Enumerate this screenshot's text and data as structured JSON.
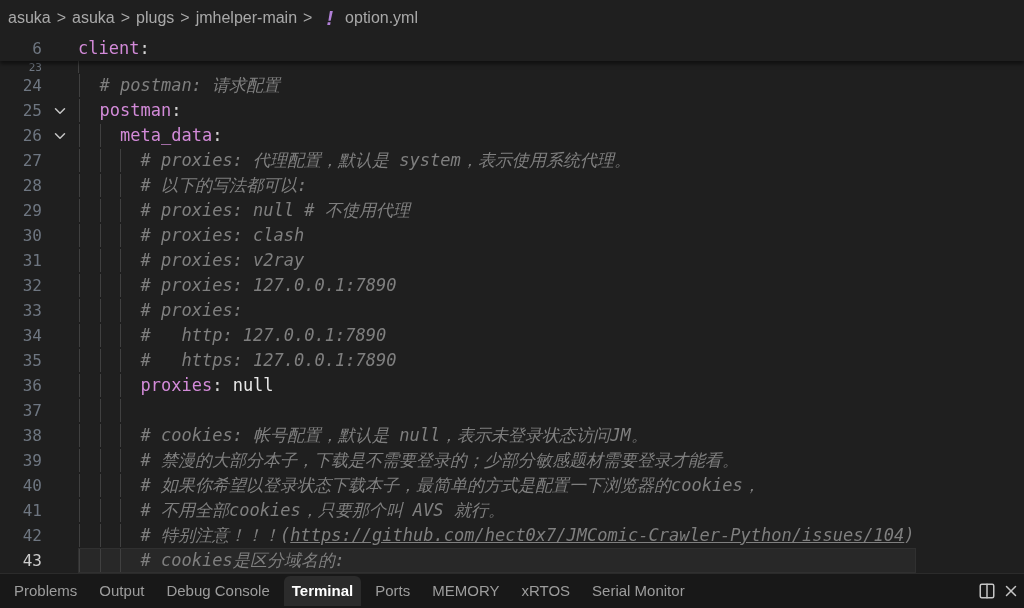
{
  "breadcrumb": {
    "items": [
      "asuka",
      "asuka",
      "plugs",
      "jmhelper-main"
    ],
    "separator": ">",
    "file_icon": "!",
    "file": "option.yml"
  },
  "sticky_line": {
    "number": "6",
    "tokens": [
      {
        "kind": "key",
        "text": "client"
      },
      {
        "kind": "punct",
        "text": ":"
      }
    ]
  },
  "peek_line": {
    "number": "23"
  },
  "lines": [
    {
      "number": "24",
      "current": false,
      "tokens": [
        {
          "kind": "comment",
          "text": "# postman: 请求配置"
        }
      ]
    },
    {
      "number": "25",
      "current": false,
      "expanded": true,
      "tokens": [
        {
          "kind": "key",
          "text": "postman"
        },
        {
          "kind": "punct",
          "text": ":"
        }
      ],
      "children": [
        {
          "number": "26",
          "current": false,
          "expanded": true,
          "tokens": [
            {
              "kind": "key",
              "text": "meta_data"
            },
            {
              "kind": "punct",
              "text": ":"
            }
          ],
          "children": [
            {
              "number": "27",
              "current": false,
              "tokens": [
                {
                  "kind": "comment",
                  "text": "# proxies: 代理配置，默认是 system，表示使用系统代理。"
                }
              ]
            },
            {
              "number": "28",
              "current": false,
              "tokens": [
                {
                  "kind": "comment",
                  "text": "# 以下的写法都可以:"
                }
              ]
            },
            {
              "number": "29",
              "current": false,
              "tokens": [
                {
                  "kind": "comment",
                  "text": "# proxies: null # 不使用代理"
                }
              ]
            },
            {
              "number": "30",
              "current": false,
              "tokens": [
                {
                  "kind": "comment",
                  "text": "# proxies: clash"
                }
              ]
            },
            {
              "number": "31",
              "current": false,
              "tokens": [
                {
                  "kind": "comment",
                  "text": "# proxies: v2ray"
                }
              ]
            },
            {
              "number": "32",
              "current": false,
              "tokens": [
                {
                  "kind": "comment",
                  "text": "# proxies: 127.0.0.1:7890"
                }
              ]
            },
            {
              "number": "33",
              "current": false,
              "tokens": [
                {
                  "kind": "comment",
                  "text": "# proxies:"
                }
              ]
            },
            {
              "number": "34",
              "current": false,
              "tokens": [
                {
                  "kind": "comment",
                  "text": "#   http: 127.0.0.1:7890"
                }
              ]
            },
            {
              "number": "35",
              "current": false,
              "tokens": [
                {
                  "kind": "comment",
                  "text": "#   https: 127.0.0.1:7890"
                }
              ]
            },
            {
              "number": "36",
              "current": false,
              "tokens": [
                {
                  "kind": "key",
                  "text": "proxies"
                },
                {
                  "kind": "punct",
                  "text": ": "
                },
                {
                  "kind": "value",
                  "text": "null"
                }
              ]
            },
            {
              "number": "37",
              "current": false
            },
            {
              "number": "38",
              "current": false,
              "tokens": [
                {
                  "kind": "comment",
                  "text": "# cookies: 帐号配置，默认是 null，表示未登录状态访问JM。"
                }
              ]
            },
            {
              "number": "39",
              "current": false,
              "tokens": [
                {
                  "kind": "comment",
                  "text": "# 禁漫的大部分本子，下载是不需要登录的；少部分敏感题材需要登录才能看。"
                }
              ]
            },
            {
              "number": "40",
              "current": false,
              "tokens": [
                {
                  "kind": "comment",
                  "text": "# 如果你希望以登录状态下载本子，最简单的方式是配置一下浏览器的cookies，"
                }
              ]
            },
            {
              "number": "41",
              "current": false,
              "tokens": [
                {
                  "kind": "comment",
                  "text": "# 不用全部cookies，只要那个叫 AVS 就行。"
                }
              ]
            },
            {
              "number": "42",
              "current": false,
              "tokens": [
                {
                  "kind": "comment",
                  "text": "# 特别注意！！！("
                },
                {
                  "kind": "link",
                  "text": "https://github.com/hect0x7/JMComic-Crawler-Python/issues/104"
                },
                {
                  "kind": "comment",
                  "text": ")"
                }
              ]
            },
            {
              "number": "43",
              "current": true,
              "tokens": [
                {
                  "kind": "comment",
                  "text": "# cookies是区分域名的:"
                }
              ]
            }
          ]
        }
      ]
    }
  ],
  "panel_tabs": [
    {
      "label": "Problems",
      "selected": false
    },
    {
      "label": "Output",
      "selected": false
    },
    {
      "label": "Debug Console",
      "selected": false
    },
    {
      "label": "Terminal",
      "selected": true
    },
    {
      "label": "Ports",
      "selected": false
    },
    {
      "label": "MEMORY",
      "selected": false
    },
    {
      "label": "xRTOS",
      "selected": false
    },
    {
      "label": "Serial Monitor",
      "selected": false
    }
  ]
}
